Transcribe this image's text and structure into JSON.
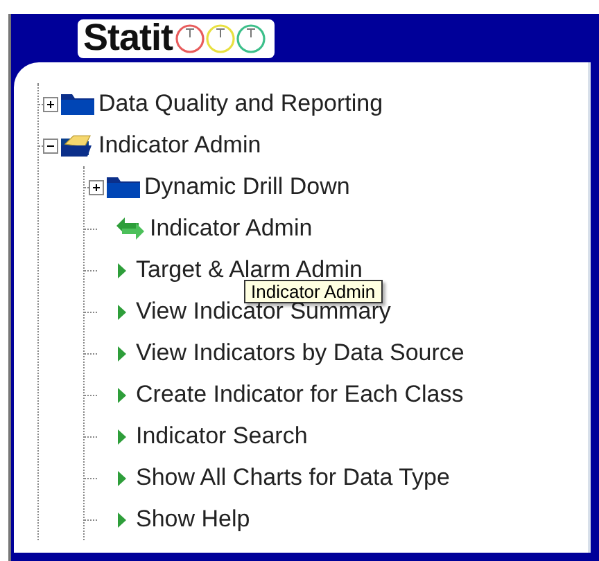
{
  "header": {
    "logo_text": "Statit"
  },
  "tree": [
    {
      "label": "Data Quality and Reporting",
      "kind": "folder",
      "expanded": false
    },
    {
      "label": "Indicator Admin",
      "kind": "folder",
      "expanded": true,
      "children": [
        {
          "label": "Dynamic Drill Down",
          "kind": "folder",
          "expanded": false
        },
        {
          "label": "Indicator Admin",
          "kind": "swap"
        },
        {
          "label": "Target & Alarm Admin",
          "kind": "leaf"
        },
        {
          "label": "View Indicator Summary",
          "kind": "leaf"
        },
        {
          "label": "View Indicators by Data Source",
          "kind": "leaf"
        },
        {
          "label": "Create Indicator for Each Class",
          "kind": "leaf"
        },
        {
          "label": "Indicator Search",
          "kind": "leaf"
        },
        {
          "label": "Show All Charts for Data Type",
          "kind": "leaf"
        },
        {
          "label": "Show Help",
          "kind": "leaf"
        }
      ]
    }
  ],
  "tooltip": "Indicator Admin"
}
